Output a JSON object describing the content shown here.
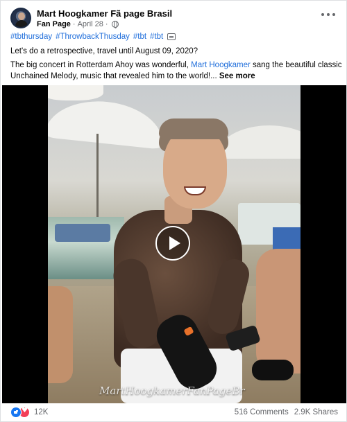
{
  "header": {
    "page_name": "Mart Hoogkamer Fã page Brasil",
    "category": "Fan Page",
    "separator": "·",
    "date": "April 28",
    "separator2": "·"
  },
  "post": {
    "hashtags": [
      "#tbthursday",
      "#ThrowbackThusday",
      "#tbt",
      "#tbt"
    ],
    "line1": "Let's do a retrospective, travel until August 09, 2020?",
    "caption_part1": "The big concert in Rotterdam Ahoy was wonderful, ",
    "mention": "Mart Hoogkamer",
    "caption_part2": "  sang the beautiful classic Unchained Melody, music that revealed him to the world!... ",
    "see_more": "See more"
  },
  "video": {
    "watermark": "MartHoogkamerFanPageBr"
  },
  "footer": {
    "reaction_count": "12K",
    "comments": "516 Comments",
    "shares": "2.9K Shares"
  },
  "icons": [
    "like-icon",
    "love-icon",
    "globe-icon",
    "play-icon",
    "more-dots-icon"
  ],
  "colors": {
    "link": "#216fdb",
    "like": "#1877f2",
    "love": "#f33e58",
    "muted": "#65676b"
  }
}
